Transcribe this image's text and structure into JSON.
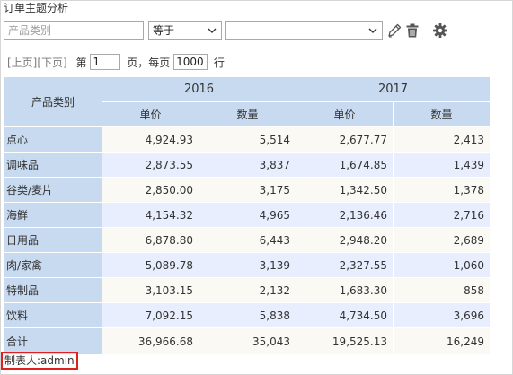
{
  "app": {
    "title": "订单主题分析"
  },
  "filter": {
    "category_placeholder": "产品类别",
    "operator_value": "等于",
    "value_selected": "",
    "icons": [
      "pencil-icon",
      "trash-icon",
      "gear-icon"
    ]
  },
  "pager": {
    "prev_label": "[上页]",
    "next_label": "[下页]",
    "page_prefix": "第",
    "page_value": "1",
    "page_suffix": "页，每页",
    "page_size_value": "1000",
    "row_suffix": "行"
  },
  "table": {
    "row_header": "产品类别",
    "years": [
      "2016",
      "2017"
    ],
    "measures": [
      "单价",
      "数量",
      "单价",
      "数量"
    ],
    "rows": [
      {
        "category": "点心",
        "values": [
          "4,924.93",
          "5,514",
          "2,677.77",
          "2,413"
        ]
      },
      {
        "category": "调味品",
        "values": [
          "2,873.55",
          "3,837",
          "1,674.85",
          "1,439"
        ]
      },
      {
        "category": "谷类/麦片",
        "values": [
          "2,850.00",
          "3,175",
          "1,342.50",
          "1,378"
        ]
      },
      {
        "category": "海鲜",
        "values": [
          "4,154.32",
          "4,965",
          "2,136.46",
          "2,716"
        ]
      },
      {
        "category": "日用品",
        "values": [
          "6,878.80",
          "6,443",
          "2,948.20",
          "2,689"
        ]
      },
      {
        "category": "肉/家禽",
        "values": [
          "5,089.78",
          "3,139",
          "2,327.55",
          "1,060"
        ]
      },
      {
        "category": "特制品",
        "values": [
          "3,103.15",
          "2,132",
          "1,683.30",
          "858"
        ]
      },
      {
        "category": "饮料",
        "values": [
          "7,092.15",
          "5,838",
          "4,734.50",
          "3,696"
        ]
      },
      {
        "category": "合计",
        "values": [
          "36,966.68",
          "35,043",
          "19,525.13",
          "16,249"
        ]
      }
    ]
  },
  "footer": {
    "author": "制表人:admin"
  },
  "colors": {
    "header_bg": "#c8daf0",
    "row_odd_bg": "#fbf9f4",
    "row_even_bg": "#e8eefd",
    "highlight_border": "#e02020"
  }
}
